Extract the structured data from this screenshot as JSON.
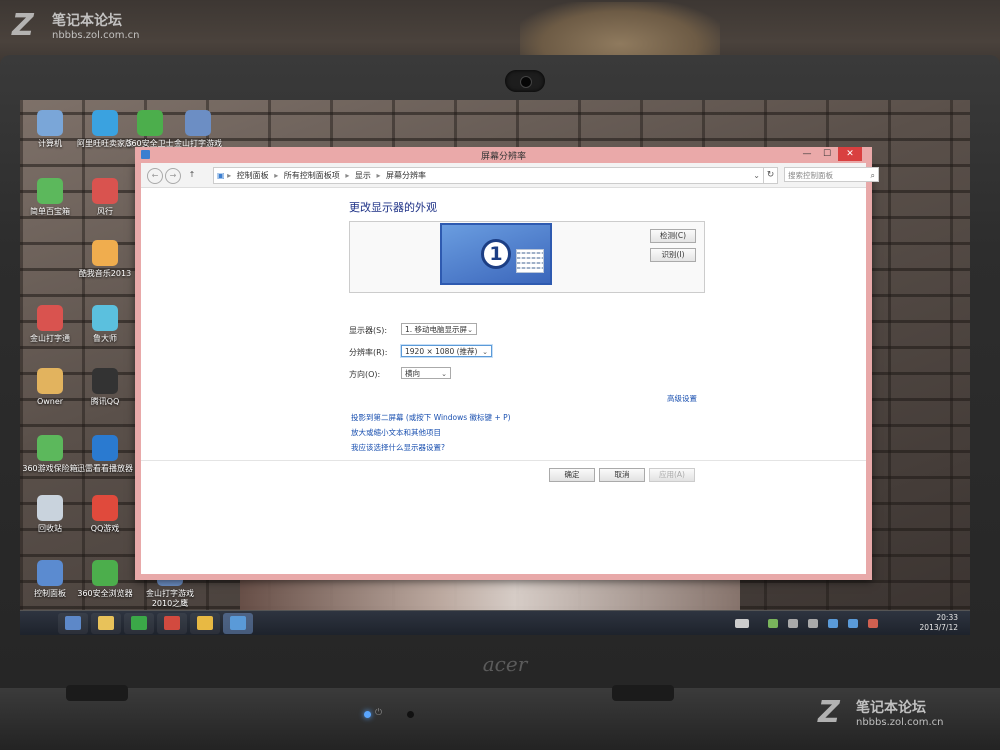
{
  "watermark": {
    "logo": "Z",
    "title": "笔记本论坛",
    "url": "nbbbs.zol.com.cn"
  },
  "laptop": {
    "brand": "acer"
  },
  "desktop_icons": [
    {
      "label": "计算机",
      "icon": "computer-icon",
      "color": "#7aa6d8"
    },
    {
      "label": "阿里旺旺卖家版",
      "icon": "aliwangwang-icon",
      "color": "#3aa2e0"
    },
    {
      "label": "360安全卫士",
      "icon": "360-safe-icon",
      "color": "#4cae4c"
    },
    {
      "label": "金山打字游戏2010之猿...",
      "icon": "game-icon",
      "color": "#6c8ec4"
    },
    {
      "label": "简单百宝箱",
      "icon": "toolbox-icon",
      "color": "#5cb85c"
    },
    {
      "label": "风行",
      "icon": "funshion-icon",
      "color": "#d9534f"
    },
    {
      "label": "360",
      "icon": "360-icon",
      "color": "#4cae4c"
    },
    {
      "label": "金山打字游戏2010之生...",
      "icon": "game-icon",
      "color": "#6c8ec4"
    },
    {
      "label": "酷我音乐2013",
      "icon": "kuwo-icon",
      "color": "#f0ad4e"
    },
    {
      "label": "lefte快",
      "icon": "app-icon",
      "color": "#888"
    },
    {
      "label": "金山打字通",
      "icon": "typing-icon",
      "color": "#d9534f"
    },
    {
      "label": "鲁大师",
      "icon": "ludashi-icon",
      "color": "#5bc0de"
    },
    {
      "label": "地下",
      "icon": "app-icon",
      "color": "#777"
    },
    {
      "label": "Owner",
      "icon": "user-folder-icon",
      "color": "#e2b35e"
    },
    {
      "label": "腾讯QQ",
      "icon": "qq-icon",
      "color": "#333"
    },
    {
      "label": "CS1",
      "icon": "app-icon",
      "color": "#777"
    },
    {
      "label": "360游戏保险箱",
      "icon": "game-safe-icon",
      "color": "#5cb85c"
    },
    {
      "label": "迅雷看看播放器",
      "icon": "xunlei-icon",
      "color": "#2a7ad0"
    },
    {
      "label": "迅雷",
      "icon": "xunlei-icon",
      "color": "#2a7ad0"
    },
    {
      "label": "回收站",
      "icon": "recycle-bin-icon",
      "color": "#c9d3dd"
    },
    {
      "label": "QQ游戏",
      "icon": "qqgame-icon",
      "color": "#e04a3c"
    },
    {
      "label": "控制面板",
      "icon": "control-panel-icon",
      "color": "#5b8bd0"
    },
    {
      "label": "360安全浏览器",
      "icon": "360-browser-icon",
      "color": "#4cae4c"
    },
    {
      "label": "金山打字游戏2010之鹰",
      "icon": "game-icon",
      "color": "#6c8ec4"
    }
  ],
  "window": {
    "title": "屏幕分辨率",
    "controls": {
      "minimize": "—",
      "maximize": "☐",
      "close": "✕"
    },
    "address": {
      "back": "←",
      "forward": "→",
      "up": "↑",
      "crumbs": [
        "控制面板",
        "所有控制面板项",
        "显示",
        "屏幕分辨率"
      ],
      "separator": "▸",
      "dropdown": "⌄",
      "refresh": "↻"
    },
    "search_placeholder": "搜索控制面板",
    "heading": "更改显示器的外观",
    "monitor_number": "1",
    "detect_button": "检测(C)",
    "identify_button": "识别(I)",
    "fields": {
      "display_label": "显示器(S):",
      "display_value": "1. 移动电脑显示屏",
      "resolution_label": "分辨率(R):",
      "resolution_value": "1920 × 1080 (推荐)",
      "orientation_label": "方向(O):",
      "orientation_value": "横向"
    },
    "advanced_link": "高级设置",
    "links": {
      "project": "投影到第二屏幕 (或按下 Windows 徽标键  + P)",
      "text_size": "放大或缩小文本和其他项目",
      "help": "我应该选择什么显示器设置?"
    },
    "buttons": {
      "ok": "确定",
      "cancel": "取消",
      "apply": "应用(A)"
    }
  },
  "taskbar": {
    "apps": [
      {
        "icon": "windows-start-icon",
        "color": "#5d88c8"
      },
      {
        "icon": "file-explorer-icon",
        "color": "#e8c25a"
      },
      {
        "icon": "360-browser-icon",
        "color": "#3ba848"
      },
      {
        "icon": "funshion-icon",
        "color": "#d24a3f"
      },
      {
        "icon": "folder-icon",
        "color": "#e8b943"
      },
      {
        "icon": "control-panel-icon",
        "color": "#5a9ad8"
      }
    ],
    "clock_time": "20:33",
    "clock_date": "2013/7/12"
  }
}
